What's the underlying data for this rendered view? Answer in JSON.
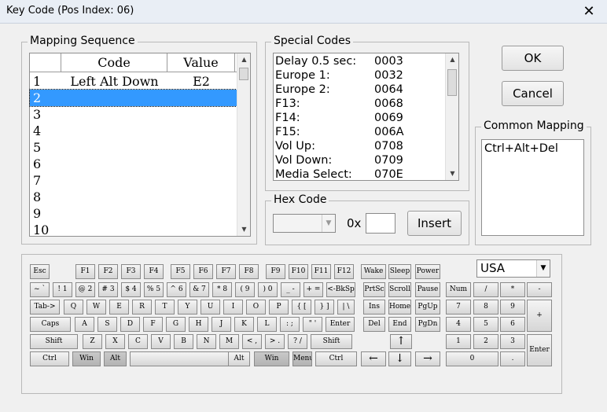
{
  "window": {
    "title": "Key Code (Pos Index: 06)",
    "close_glyph": "✕"
  },
  "mapping": {
    "legend": "Mapping Sequence",
    "col_code": "Code",
    "col_value": "Value",
    "rows": [
      {
        "idx": "1",
        "code": "Left Alt Down",
        "value": "E2"
      },
      {
        "idx": "2",
        "code": "",
        "value": ""
      },
      {
        "idx": "3",
        "code": "",
        "value": ""
      },
      {
        "idx": "4",
        "code": "",
        "value": ""
      },
      {
        "idx": "5",
        "code": "",
        "value": ""
      },
      {
        "idx": "6",
        "code": "",
        "value": ""
      },
      {
        "idx": "7",
        "code": "",
        "value": ""
      },
      {
        "idx": "8",
        "code": "",
        "value": ""
      },
      {
        "idx": "9",
        "code": "",
        "value": ""
      },
      {
        "idx": "10",
        "code": "",
        "value": ""
      }
    ],
    "selected_row": "2"
  },
  "special": {
    "legend": "Special Codes",
    "items": [
      {
        "name": "Delay 0.5 sec:",
        "code": "0003"
      },
      {
        "name": "Europe 1:",
        "code": "0032"
      },
      {
        "name": "Europe 2:",
        "code": "0064"
      },
      {
        "name": "F13:",
        "code": "0068"
      },
      {
        "name": "F14:",
        "code": "0069"
      },
      {
        "name": "F15:",
        "code": "006A"
      },
      {
        "name": "Vol Up:",
        "code": "0708"
      },
      {
        "name": "Vol Down:",
        "code": "0709"
      },
      {
        "name": "Media Select:",
        "code": "070E"
      }
    ]
  },
  "buttons": {
    "ok": "OK",
    "cancel": "Cancel",
    "insert": "Insert"
  },
  "common": {
    "legend": "Common Mapping",
    "items": [
      "Ctrl+Alt+Del"
    ]
  },
  "hex": {
    "legend": "Hex Code",
    "prefix": "0x",
    "value": "",
    "combo_value": ""
  },
  "layout_select": {
    "value": "USA"
  },
  "keys": {
    "row1": [
      "Esc",
      "F1",
      "F2",
      "F3",
      "F4",
      "F5",
      "F6",
      "F7",
      "F8",
      "F9",
      "F10",
      "F11",
      "F12",
      "Wake",
      "Sleep",
      "Power"
    ],
    "row2": [
      "~ `",
      "! 1",
      "@ 2",
      "# 3",
      "$ 4",
      "% 5",
      "^ 6",
      "& 7",
      "* 8",
      "( 9",
      ") 0",
      "_ -",
      "+ =",
      "<-BkSp",
      "PrtSc",
      "Scroll",
      "Pause",
      "Num",
      "/",
      "*",
      "-"
    ],
    "row3": [
      "Tab->",
      "Q",
      "W",
      "E",
      "R",
      "T",
      "Y",
      "U",
      "I",
      "O",
      "P",
      "{ [",
      "} ]",
      "| \\",
      "Ins",
      "Home",
      "PgUp",
      "7",
      "8",
      "9",
      "+"
    ],
    "row4": [
      "Caps",
      "A",
      "S",
      "D",
      "F",
      "G",
      "H",
      "J",
      "K",
      "L",
      ": ;",
      "\" '",
      "Enter",
      "Del",
      "End",
      "PgDn",
      "4",
      "5",
      "6"
    ],
    "row5": [
      "Shift",
      "Z",
      "X",
      "C",
      "V",
      "B",
      "N",
      "M",
      "< ,",
      "> .",
      "? /",
      "Shift",
      "↑",
      "1",
      "2",
      "3",
      "Enter"
    ],
    "row6": [
      "Ctrl",
      "Win",
      "Alt",
      "",
      "Alt",
      "Win",
      "Menu",
      "Ctrl",
      "←",
      "↓",
      "→",
      "0",
      "."
    ]
  }
}
